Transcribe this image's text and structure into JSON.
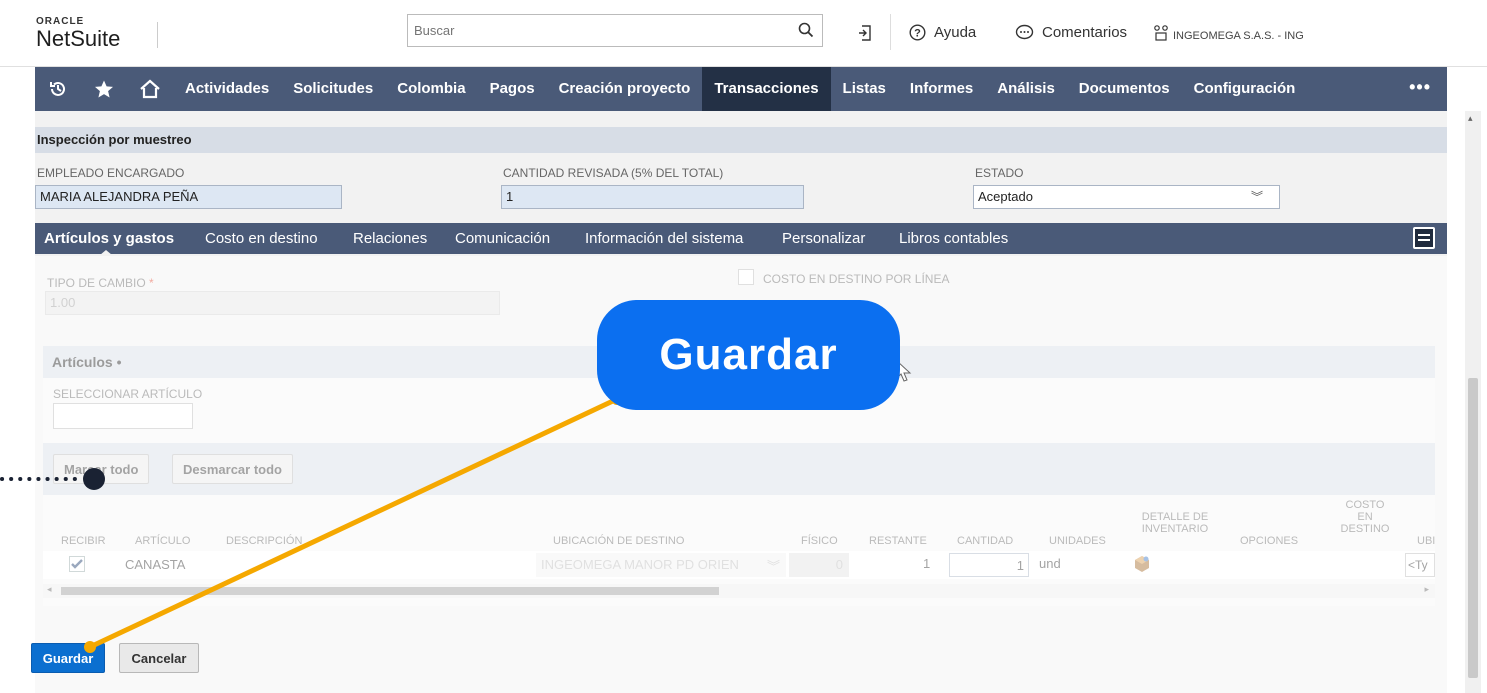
{
  "header": {
    "logo_top": "ORACLE",
    "logo_main": "NetSuite",
    "search_placeholder": "Buscar",
    "help": "Ayuda",
    "comments": "Comentarios",
    "company": "INGEOMEGA S.A.S. - ING"
  },
  "nav": {
    "items": [
      "Actividades",
      "Solicitudes",
      "Colombia",
      "Pagos",
      "Creación proyecto",
      "Transacciones",
      "Listas",
      "Informes",
      "Análisis",
      "Documentos",
      "Configuración"
    ],
    "active": "Transacciones",
    "more": "•••"
  },
  "inspection": {
    "title": "Inspección por muestreo",
    "employee_label": "EMPLEADO ENCARGADO",
    "employee_value": "MARIA ALEJANDRA PEÑA",
    "qty_label": "CANTIDAD REVISADA (5% DEL TOTAL)",
    "qty_value": "1",
    "status_label": "ESTADO",
    "status_value": "Aceptado"
  },
  "subtabs": [
    "Artículos y gastos",
    "Costo en destino",
    "Relaciones",
    "Comunicación",
    "Información del sistema",
    "Personalizar",
    "Libros contables"
  ],
  "exchange": {
    "label": "TIPO DE CAMBIO",
    "required": "*",
    "value": "1.00",
    "landed_cost_label": "COSTO EN DESTINO POR LÍNEA"
  },
  "items": {
    "title": "Artículos •",
    "select_label": "SELECCIONAR ARTÍCULO",
    "mark_all": "Marcar todo",
    "unmark_all": "Desmarcar todo",
    "columns": [
      "RECIBIR",
      "ARTÍCULO",
      "DESCRIPCIÓN",
      "UBICACIÓN DE DESTINO",
      "FÍSICO",
      "RESTANTE",
      "CANTIDAD",
      "UNIDADES",
      "DETALLE DE INVENTARIO",
      "OPCIONES",
      "COSTO EN DESTINO",
      "UBI"
    ],
    "row": {
      "article": "CANASTA",
      "location": "INGEOMEGA MANOR PD ORIEN",
      "physical": "0",
      "remaining": "1",
      "quantity": "1",
      "units": "und",
      "ubi": "<Ty"
    }
  },
  "buttons": {
    "save": "Guardar",
    "cancel": "Cancelar"
  },
  "callout": {
    "text": "Guardar",
    "color": "#0b6ff0",
    "pointer_color": "#f5a800"
  }
}
